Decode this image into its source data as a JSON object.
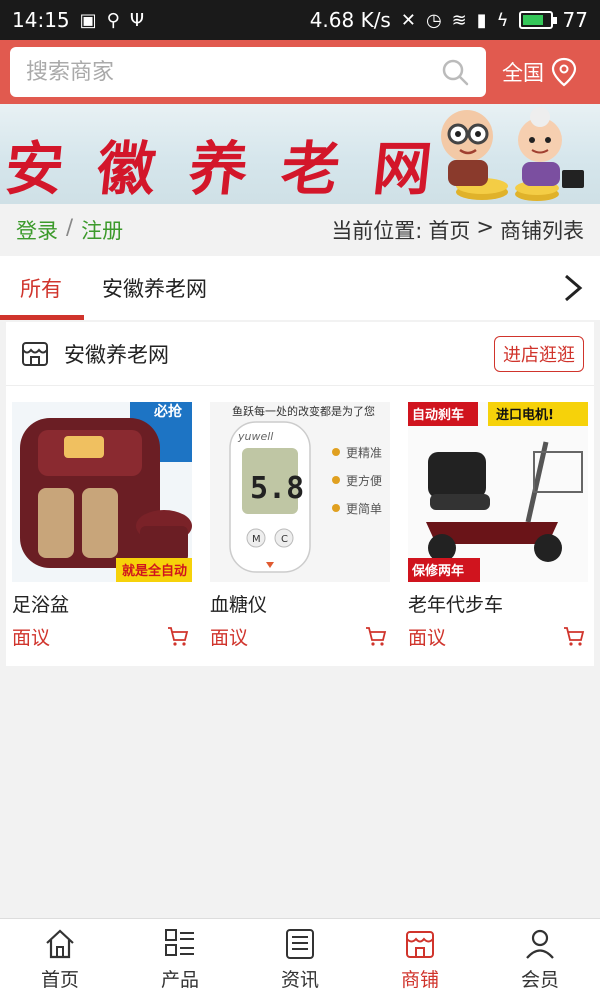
{
  "status_bar": {
    "time": "14:15",
    "speed": "4.68 K/s",
    "battery": "77"
  },
  "search": {
    "placeholder": "搜索商家",
    "region": "全国"
  },
  "banner": {
    "title": "安徽养老网"
  },
  "crumb": {
    "login": "登录",
    "separator": "/",
    "register": "注册",
    "location_label": "当前位置:",
    "home": "首页",
    "arrow": ">",
    "current": "商铺列表"
  },
  "tabs": [
    {
      "label": "所有",
      "active": true
    },
    {
      "label": "安徽养老网",
      "active": false
    }
  ],
  "store": {
    "name": "安徽养老网",
    "visit_label": "进店逛逛",
    "products": [
      {
        "name": "足浴盆",
        "price": "面议",
        "image_badge": "就是全自动",
        "image_tag": "必抢"
      },
      {
        "name": "血糖仪",
        "price": "面议",
        "image_header": "鱼跃每一处的改变都是为了您",
        "brand": "yuwell",
        "reading": "5.8",
        "features": [
          "更精准",
          "更方便",
          "更简单"
        ]
      },
      {
        "name": "老年代步车",
        "price": "面议",
        "image_tag_left": "自动刹车",
        "image_tag_right": "进口电机!",
        "image_badge": "保修两年"
      }
    ]
  },
  "bottom_nav": [
    {
      "label": "首页",
      "icon": "home-icon",
      "active": false
    },
    {
      "label": "产品",
      "icon": "product-grid-icon",
      "active": false
    },
    {
      "label": "资讯",
      "icon": "news-icon",
      "active": false
    },
    {
      "label": "商铺",
      "icon": "shop-icon",
      "active": true
    },
    {
      "label": "会员",
      "icon": "user-icon",
      "active": false
    }
  ],
  "colors": {
    "brand": "#e15a4f",
    "accent": "#d0342c",
    "link_green": "#3c9a2b"
  }
}
